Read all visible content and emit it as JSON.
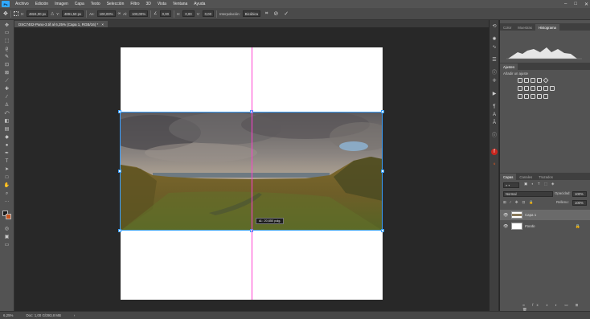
{
  "menubar": {
    "logo": "Ps",
    "items": [
      "Archivo",
      "Edición",
      "Imagen",
      "Capa",
      "Texto",
      "Selección",
      "Filtro",
      "3D",
      "Vista",
      "Ventana",
      "Ayuda"
    ]
  },
  "window_controls": {
    "minimize": "–",
    "maximize": "□",
    "close": "✕"
  },
  "options_bar": {
    "x_label": "X:",
    "x_value": "4824,00 px",
    "y_label": "Y:",
    "y_value": "4891,50 px",
    "w_label": "An:",
    "w_value": "100,00%",
    "h_label": "Al:",
    "h_value": "100,00%",
    "angle_value": "0,00",
    "h_skew_label": "H:",
    "h_skew_value": "0,00",
    "v_skew_label": "V:",
    "v_skew_value": "0,00",
    "interp_label": "Interpolación:",
    "interp_value": "Bicúbica",
    "cancel_glyph": "⊘",
    "commit_glyph": "✓"
  },
  "document_tab": {
    "title": "DSC7402-Pano-3.tif al 6,25% (Capa 1, RGB/16) *",
    "close": "×"
  },
  "tooltip": {
    "text": "Al.: 20,650 pulg."
  },
  "status": {
    "zoom": "6,25%",
    "doc": "Doc: 1,00 G/393,8 MB",
    "arrow": "›"
  },
  "right_panel": {
    "top_tabs": [
      "Color",
      "Muestras",
      "Histograma"
    ],
    "adjust_tabs": [
      "Ajustes"
    ],
    "adjust_hint": "Añadir un ajuste",
    "layers_tabs": [
      "Capas",
      "Canales",
      "Trazados"
    ],
    "blend_mode": "Normal",
    "opacity_label": "Opacidad:",
    "opacity_value": "100%",
    "fill_label": "Relleno:",
    "fill_value": "100%",
    "layers": [
      {
        "name": "Capa 1"
      },
      {
        "name": "Fondo"
      }
    ],
    "colors": {
      "accent": "#31a8ff",
      "panel": "#535353",
      "selected": "#6a6a6a"
    }
  },
  "guide_color": "#ff3fd0",
  "bbox_color": "#3aa0ff"
}
